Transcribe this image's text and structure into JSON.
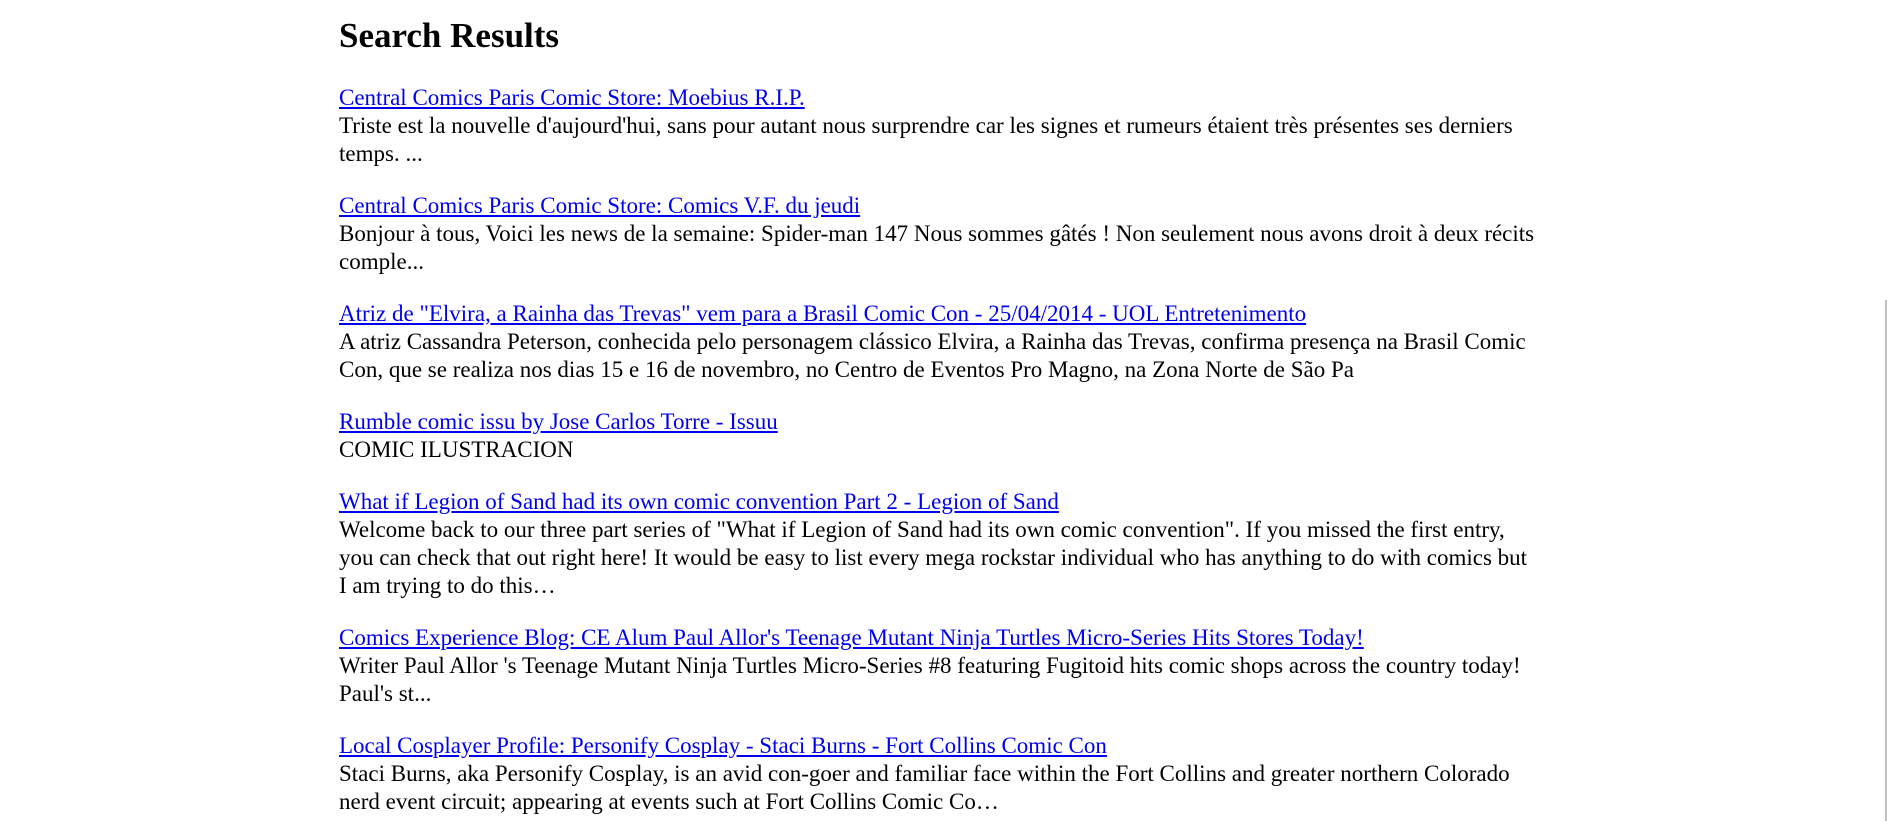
{
  "page": {
    "title": "Search Results"
  },
  "results": [
    {
      "title": "Central Comics Paris Comic Store: Moebius R.I.P.",
      "snippet": "Triste est la nouvelle d'aujourd'hui, sans pour autant nous surprendre car les signes et rumeurs étaient très présentes ses derniers temps. ..."
    },
    {
      "title": "Central Comics Paris Comic Store: Comics V.F. du jeudi",
      "snippet": "Bonjour à tous, Voici les news de la semaine: Spider-man 147 Nous sommes gâtés ! Non seulement nous avons droit à deux récits comple..."
    },
    {
      "title": "Atriz de \"Elvira, a Rainha das Trevas\" vem para a Brasil Comic Con - 25/04/2014 - UOL Entretenimento",
      "snippet": "A atriz Cassandra Peterson, conhecida pelo personagem clássico Elvira, a Rainha das Trevas, confirma presença na Brasil Comic Con, que se realiza nos dias 15 e 16 de novembro, no Centro de Eventos Pro Magno, na Zona Norte de São Pa"
    },
    {
      "title": "Rumble comic issu by Jose Carlos Torre - Issuu",
      "snippet": "COMIC ILUSTRACION"
    },
    {
      "title": "What if Legion of Sand had its own comic convention Part 2 - Legion of Sand",
      "snippet": "Welcome back to our three part series of \"What if Legion of Sand had its own comic convention\". If you missed the first entry, you can check that out right here! It would be easy to list every mega rockstar individual who has anything to do with comics but I am trying to do this…"
    },
    {
      "title": "Comics Experience Blog: CE Alum Paul Allor's Teenage Mutant Ninja Turtles Micro-Series Hits Stores Today!",
      "snippet": "Writer Paul Allor 's Teenage Mutant Ninja Turtles Micro-Series #8 featuring Fugitoid hits comic shops across the country today! Paul's st..."
    },
    {
      "title": "Local Cosplayer Profile: Personify Cosplay - Staci Burns - Fort Collins Comic Con",
      "snippet": "Staci Burns, aka Personify Cosplay, is an avid con-goer and familiar face within the Fort Collins and greater northern Colorado nerd event circuit; appearing at events such at Fort Collins Comic Co…"
    }
  ]
}
